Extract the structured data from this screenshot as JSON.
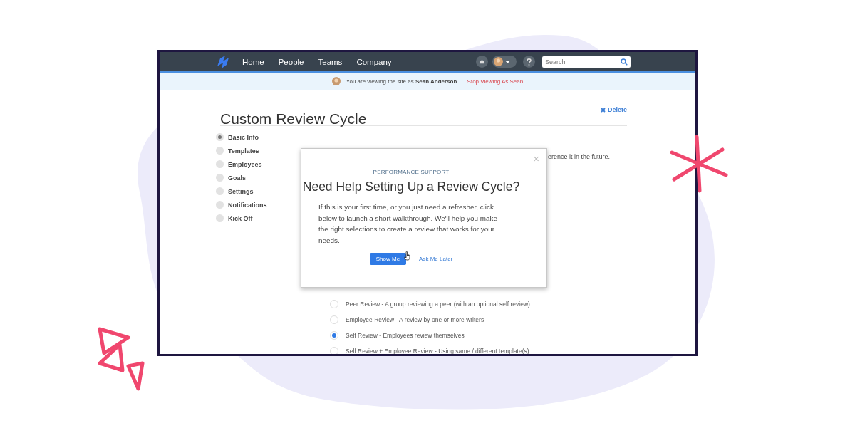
{
  "nav": {
    "links": [
      {
        "label": "Home"
      },
      {
        "label": "People"
      },
      {
        "label": "Teams"
      },
      {
        "label": "Company"
      }
    ],
    "search": {
      "placeholder": "Search"
    }
  },
  "banner": {
    "text": "You are viewing the site as **Sean Anderson**.",
    "link": "Stop Viewing As Sean"
  },
  "page": {
    "title": "Custom Review Cycle",
    "delete": "Delete"
  },
  "steps": [
    {
      "label": "Basic Info",
      "selected": true
    },
    {
      "label": "Templates",
      "selected": false
    },
    {
      "label": "Employees",
      "selected": false
    },
    {
      "label": "Goals",
      "selected": false
    },
    {
      "label": "Settings",
      "selected": false
    },
    {
      "label": "Notifications",
      "selected": false
    },
    {
      "label": "Kick Off",
      "selected": false
    }
  ],
  "partial_text": "erence it in the future.",
  "modal": {
    "close": "×",
    "eyebrow": "PERFORMANCE SUPPORT",
    "title": "Need Help Setting Up a Review Cycle?",
    "body": "If this is your first time, or you just need a refresher, click below to launch a short walkthrough. We'll help you make the right selections to create a review that works for your needs.",
    "primary": "Show Me",
    "secondary": "Ask Me Later"
  },
  "review_options": [
    {
      "label": "Peer Review - A group reviewing a peer (with an optional self review)",
      "selected": false
    },
    {
      "label": "Employee Review - A review by one or more writers",
      "selected": false
    },
    {
      "label": "Self Review - Employees review themselves",
      "selected": true
    },
    {
      "label": "Self Review + Employee Review - Using same / different template(s)",
      "selected": false
    }
  ]
}
